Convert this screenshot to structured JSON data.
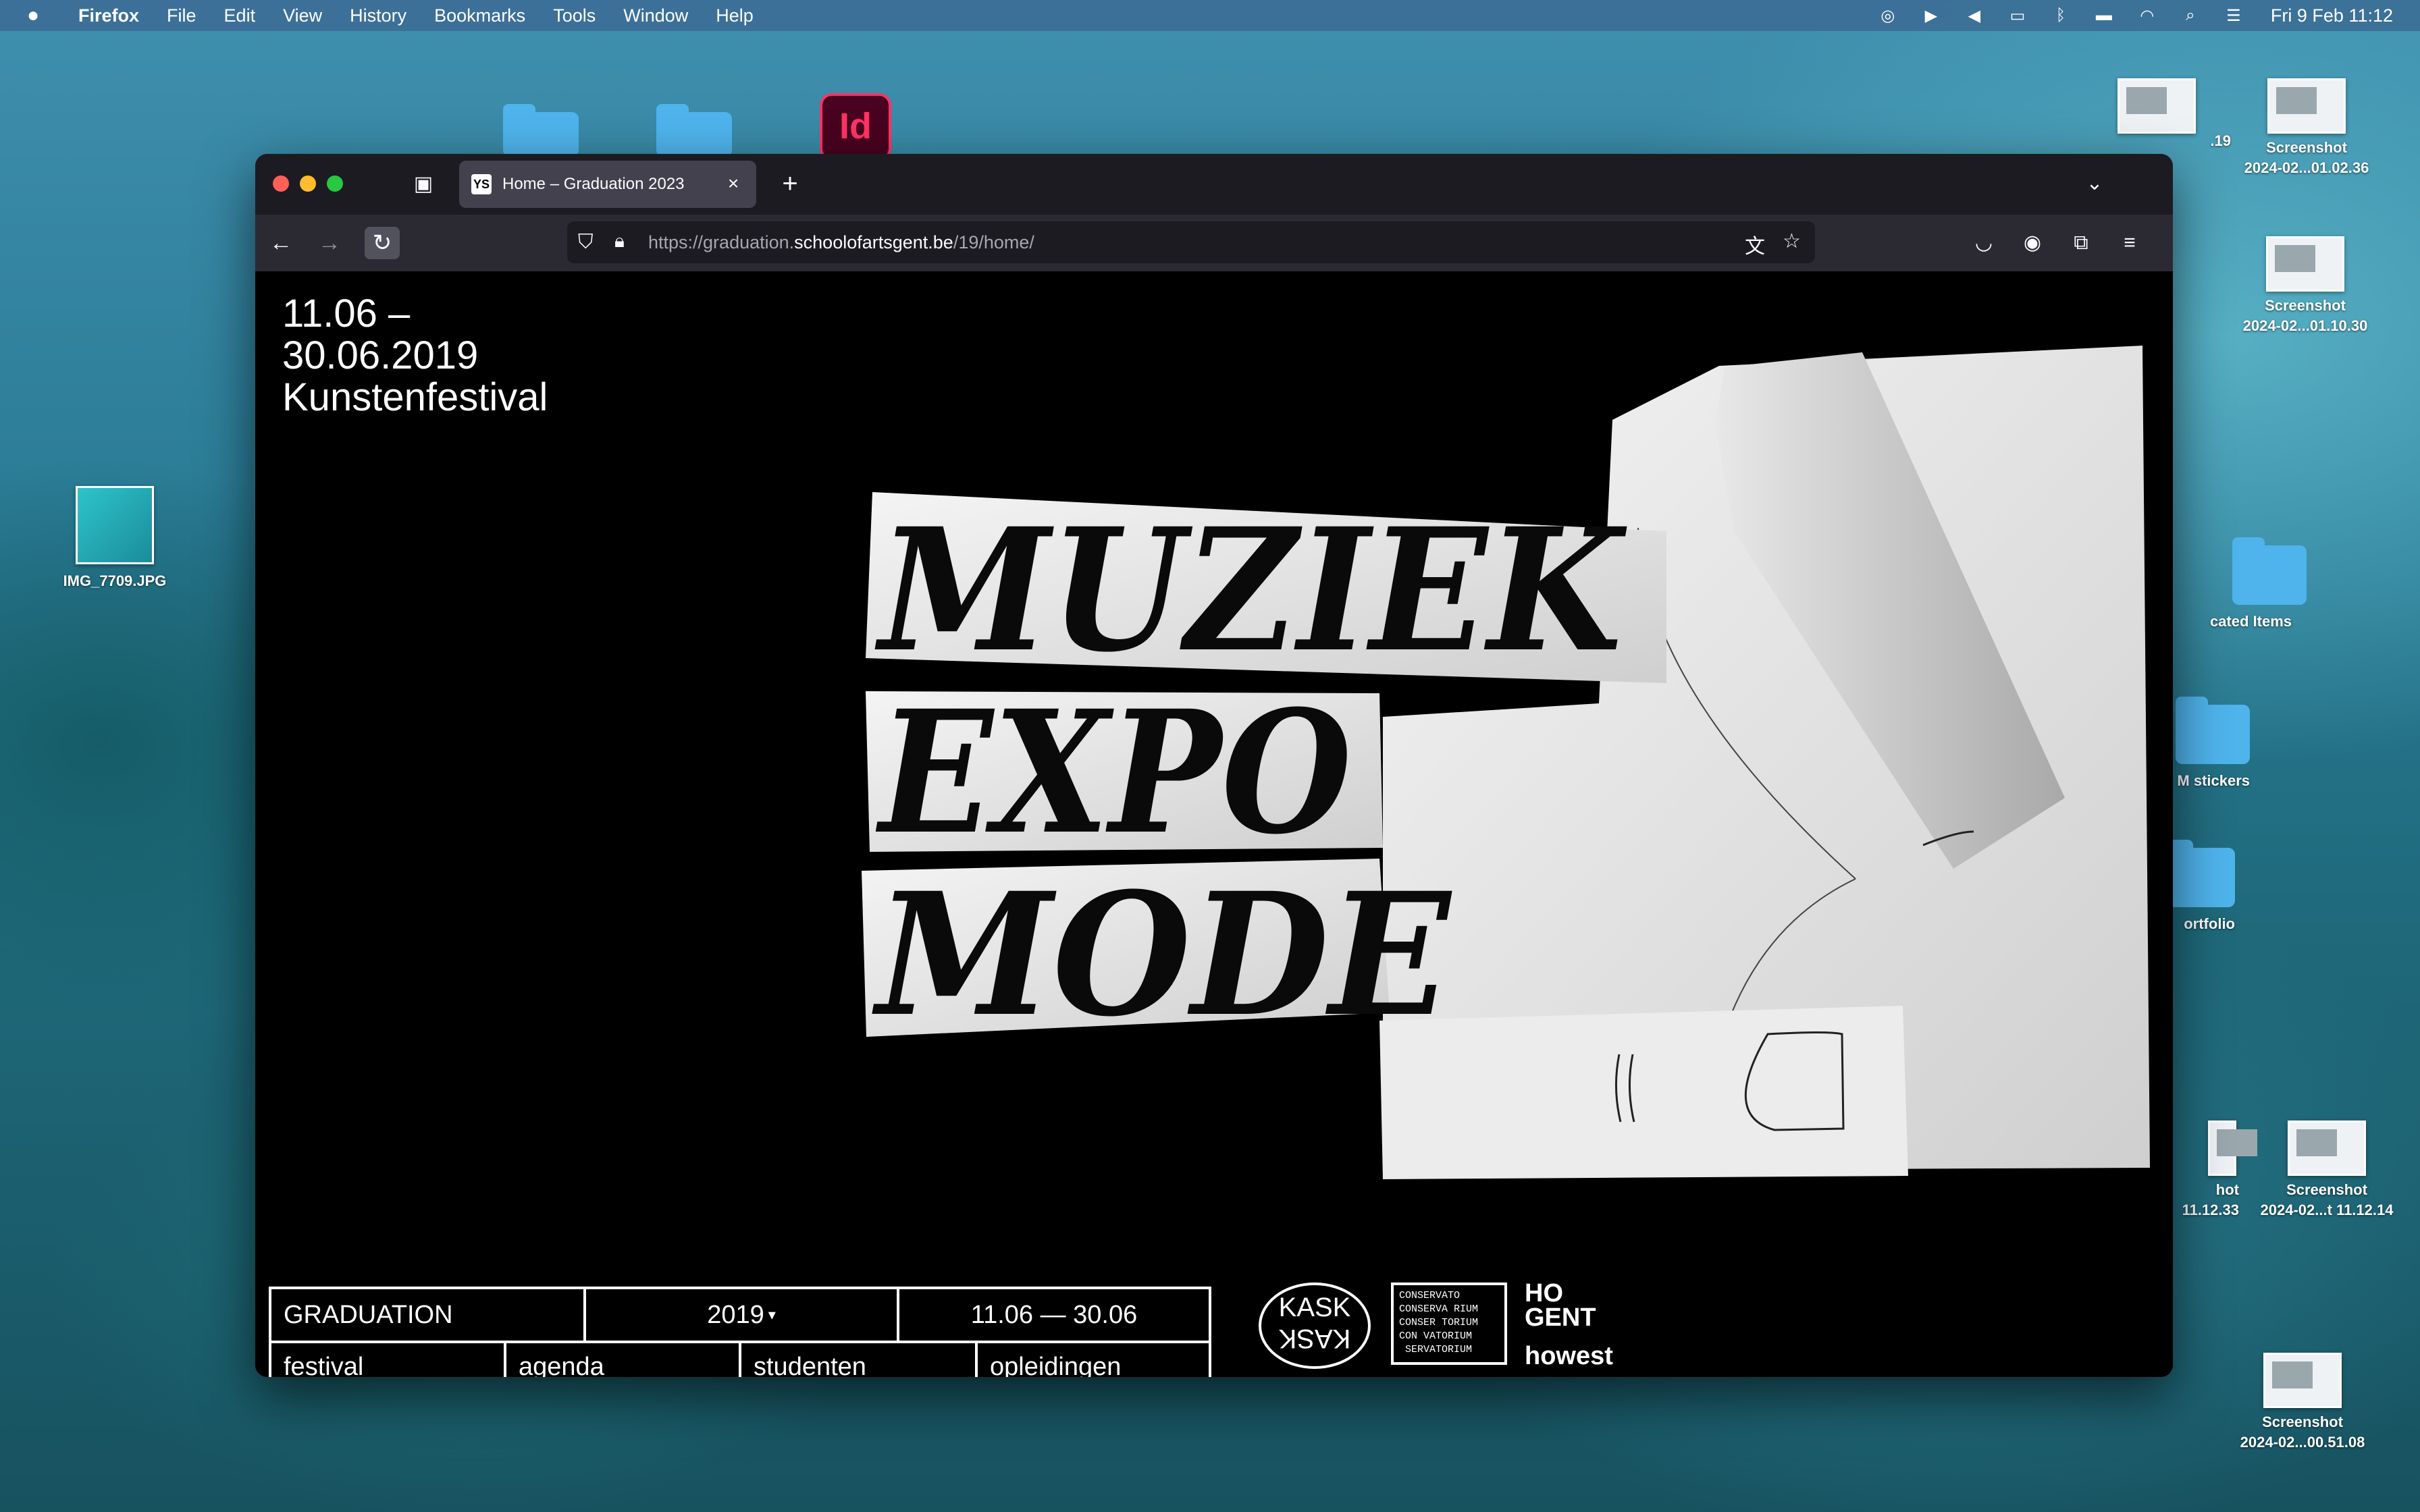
{
  "menubar": {
    "apple": "",
    "app": "Firefox",
    "items": [
      "File",
      "Edit",
      "View",
      "History",
      "Bookmarks",
      "Tools",
      "Window",
      "Help"
    ],
    "clock": "Fri 9 Feb  11:12"
  },
  "desktop": {
    "right_icons": [
      {
        "label": ".19",
        "kind": "thumb"
      },
      {
        "label1": "Screenshot",
        "label2": "2024-02...01.02.36"
      },
      {
        "label1": "Screenshot",
        "label2": "2024-02...01.10.30"
      },
      {
        "label": "cated Items"
      },
      {
        "label": "M stickers"
      },
      {
        "label": "ortfolio"
      },
      {
        "label1": "hot",
        "label2": "11.12.33"
      },
      {
        "label1": "Screenshot",
        "label2": "2024-02...t 11.12.14"
      },
      {
        "label1": "Screenshot",
        "label2": "2024-02...00.51.08"
      }
    ],
    "left_icon": "IMG_7709.JPG",
    "app_icon": "Id"
  },
  "browser": {
    "tab_title": "Home – Graduation 2023",
    "tab_favicon": "YS",
    "url_prefix": "https://graduation.",
    "url_domain": "schoolofartsgent.be",
    "url_path": "/19/home/"
  },
  "page": {
    "dates_line1": "11.06 –",
    "dates_line2": "30.06.2019",
    "dates_line3": "Kunstenfestival",
    "artwork_words": [
      "MUZIEK",
      "EXPO",
      "MODE"
    ],
    "nav": {
      "title": "GRADUATION",
      "year": "2019",
      "range": "11.06 — 30.06",
      "links": [
        "festival",
        "agenda",
        "studenten",
        "opleidingen"
      ]
    },
    "logos": {
      "kask_top": "KASK",
      "kask_bottom": "KASK",
      "conservatorium": "CONSERVATO\nCONSERVA RIUM\nCONSER TORIUM\nCON VATORIUM\n SERVATORIUM",
      "hogent_1": "HO",
      "hogent_2": "GENT",
      "howest": "howest"
    }
  }
}
